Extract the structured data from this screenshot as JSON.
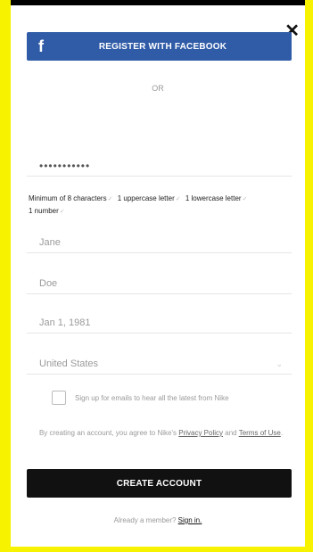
{
  "facebook": {
    "icon": "facebook-icon",
    "icon_glyph": "f",
    "label": "REGISTER WITH FACEBOOK",
    "color": "#2f5ba7"
  },
  "divider": {
    "text": "OR"
  },
  "close": {
    "icon": "close-icon",
    "glyph": "✕"
  },
  "password": {
    "value": "•••••••••••"
  },
  "password_rules": {
    "rule1": "Minimum of 8 characters",
    "rule2": "1 uppercase letter",
    "rule3": "1 lowercase letter",
    "rule4": "1 number",
    "tick_glyph": "✓"
  },
  "fields": {
    "first_name_placeholder": "Jane",
    "last_name_placeholder": "Doe",
    "dob_placeholder": "Jan 1, 1981",
    "country_value": "United States",
    "country_chevron": "⌄"
  },
  "emails": {
    "label": "Sign up for emails to hear all the latest from Nike"
  },
  "terms": {
    "prefix": "By creating an account, you agree to Nike's ",
    "privacy": "Privacy Policy",
    "and": " and ",
    "tou": "Terms of Use",
    "suffix": "."
  },
  "create": {
    "label": "CREATE ACCOUNT",
    "color": "#111111"
  },
  "member": {
    "prefix": "Already a member? ",
    "signin": "Sign in."
  },
  "colors": {
    "frame": "#f7f200"
  }
}
